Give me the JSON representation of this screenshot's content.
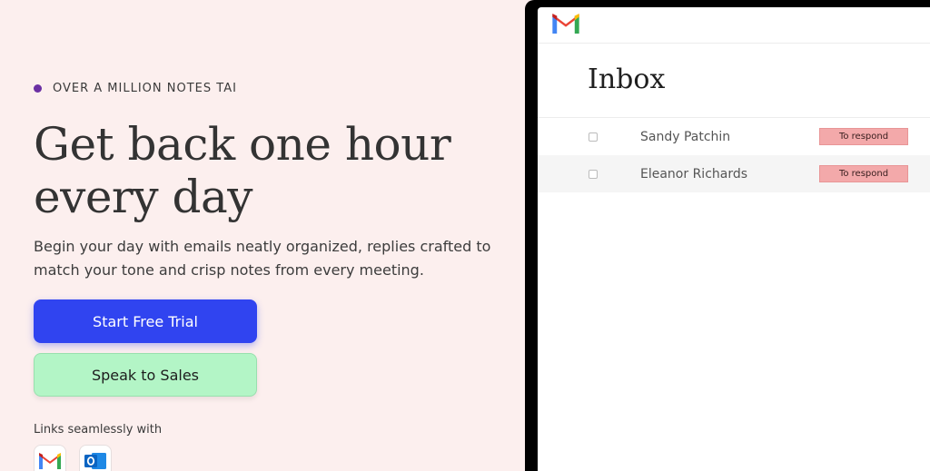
{
  "hero": {
    "kicker": "OVER A MILLION NOTES TAI",
    "headline_line1": "Get back one hour",
    "headline_line2": "every day",
    "subtext": "Begin your day with emails neatly organized, replies crafted to match your tone and crisp notes from every meeting.",
    "primary_cta": "Start Free Trial",
    "secondary_cta": "Speak to Sales",
    "links_label": "Links seamlessly with",
    "integrations": [
      "gmail-icon",
      "outlook-icon"
    ]
  },
  "preview": {
    "logo": "gmail-icon",
    "inbox_title": "Inbox",
    "rows": [
      {
        "sender": "Sandy Patchin",
        "tag": "To respond"
      },
      {
        "sender": "Eleanor Richards",
        "tag": "To respond"
      }
    ]
  },
  "colors": {
    "page_bg": "#fcefee",
    "primary": "#3044f0",
    "secondary": "#b3f5c6",
    "tag": "#f3a9aa",
    "kicker_dot": "#6b2fa3"
  }
}
